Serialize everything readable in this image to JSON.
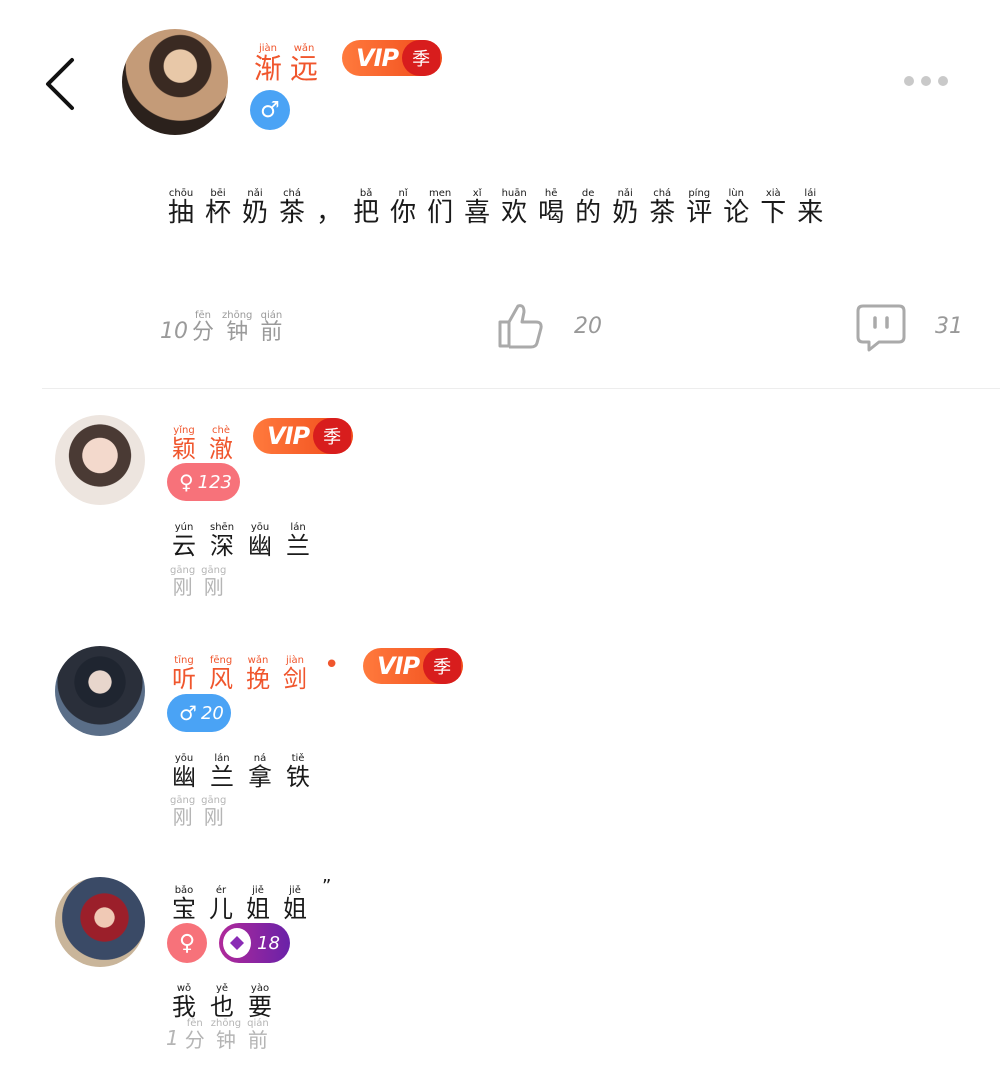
{
  "post": {
    "author": {
      "name": [
        {
          "h": "渐",
          "p": "jiàn"
        },
        {
          "h": "远",
          "p": "wǎn"
        }
      ],
      "vip_label": "VIP",
      "vip_season": "季",
      "gender": "♂"
    },
    "content": [
      {
        "h": "抽",
        "p": "chōu"
      },
      {
        "h": "杯",
        "p": "bēi"
      },
      {
        "h": "奶",
        "p": "nǎi"
      },
      {
        "h": "茶",
        "p": "chá"
      },
      {
        "h": "，",
        "p": ""
      },
      {
        "h": "把",
        "p": "bǎ"
      },
      {
        "h": "你",
        "p": "nǐ"
      },
      {
        "h": "们",
        "p": "men"
      },
      {
        "h": "喜",
        "p": "xǐ"
      },
      {
        "h": "欢",
        "p": "huān"
      },
      {
        "h": "喝",
        "p": "hē"
      },
      {
        "h": "的",
        "p": "de"
      },
      {
        "h": "奶",
        "p": "nǎi"
      },
      {
        "h": "茶",
        "p": "chá"
      },
      {
        "h": "评",
        "p": "píng"
      },
      {
        "h": "论",
        "p": "lùn"
      },
      {
        "h": "下",
        "p": "xià"
      },
      {
        "h": "来",
        "p": "lái"
      }
    ],
    "time": {
      "num": "10",
      "chars": [
        {
          "h": "分",
          "p": "fēn"
        },
        {
          "h": "钟",
          "p": "zhōng"
        },
        {
          "h": "前",
          "p": "qián"
        }
      ]
    },
    "likes": "20",
    "comments": "31"
  },
  "comments": [
    {
      "name": [
        {
          "h": "颖",
          "p": "yǐng"
        },
        {
          "h": "澈",
          "p": "chè"
        }
      ],
      "name_color": "#f0562d",
      "vip": true,
      "vip_label": "VIP",
      "vip_season": "季",
      "gender": "♀",
      "level": "123",
      "text": [
        {
          "h": "云",
          "p": "yún"
        },
        {
          "h": "深",
          "p": "shēn"
        },
        {
          "h": "幽",
          "p": "yōu"
        },
        {
          "h": "兰",
          "p": "lán"
        }
      ],
      "time": [
        {
          "h": "刚",
          "p": "gāng"
        },
        {
          "h": "刚",
          "p": "gāng"
        }
      ]
    },
    {
      "name": [
        {
          "h": "听",
          "p": "tīng"
        },
        {
          "h": "风",
          "p": "fēng"
        },
        {
          "h": "挽",
          "p": "wǎn"
        },
        {
          "h": "剑",
          "p": "jiàn"
        }
      ],
      "name_color": "#f0562d",
      "dot": "•",
      "vip": true,
      "vip_label": "VIP",
      "vip_season": "季",
      "gender": "♂",
      "level": "20",
      "text": [
        {
          "h": "幽",
          "p": "yōu"
        },
        {
          "h": "兰",
          "p": "lán"
        },
        {
          "h": "拿",
          "p": "ná"
        },
        {
          "h": "铁",
          "p": "tiě"
        }
      ],
      "time": [
        {
          "h": "刚",
          "p": "gāng"
        },
        {
          "h": "刚",
          "p": "gāng"
        }
      ]
    },
    {
      "name": [
        {
          "h": "宝",
          "p": "bǎo"
        },
        {
          "h": "儿",
          "p": "ér"
        },
        {
          "h": "姐",
          "p": "jiě"
        },
        {
          "h": "姐",
          "p": "jiě"
        }
      ],
      "name_suffix": "”",
      "name_color": "#1a1a1a",
      "vip": false,
      "gender": "♀",
      "level": "18",
      "text": [
        {
          "h": "我",
          "p": "wǒ"
        },
        {
          "h": "也",
          "p": "yě"
        },
        {
          "h": "要",
          "p": "yào"
        }
      ],
      "time_num": "1",
      "time": [
        {
          "h": "分",
          "p": "fēn"
        },
        {
          "h": "钟",
          "p": "zhōng"
        },
        {
          "h": "前",
          "p": "qián"
        }
      ]
    }
  ],
  "colors": {
    "accent": "#f0562d",
    "male": "#4aa3f5",
    "female": "#f7727a",
    "diamond_badge": "#8a2bb5",
    "meta": "#9a9a9a"
  }
}
